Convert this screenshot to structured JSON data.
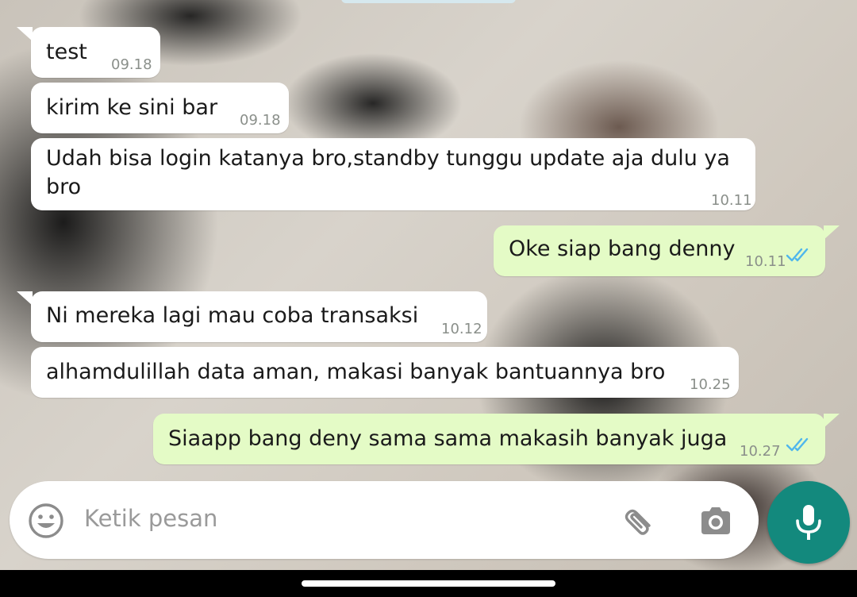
{
  "messages": [
    {
      "id": "m1",
      "direction": "in",
      "lines": [
        "test"
      ],
      "time": "09.18"
    },
    {
      "id": "m2",
      "direction": "in",
      "lines": [
        "kirim ke sini bar"
      ],
      "time": "09.18"
    },
    {
      "id": "m3",
      "direction": "in",
      "lines": [
        "Udah bisa login katanya bro,standby tunggu update aja dulu ya",
        "bro"
      ],
      "time": "10.11"
    },
    {
      "id": "m4",
      "direction": "out",
      "lines": [
        "Oke siap bang denny"
      ],
      "time": "10.11",
      "status": "read"
    },
    {
      "id": "m5",
      "direction": "in",
      "lines": [
        "Ni mereka lagi mau coba transaksi"
      ],
      "time": "10.12"
    },
    {
      "id": "m6",
      "direction": "in",
      "lines": [
        "alhamdulillah data aman, makasi banyak bantuannya bro"
      ],
      "time": "10.25"
    },
    {
      "id": "m7",
      "direction": "out",
      "lines": [
        "Siaapp bang deny sama sama makasih banyak juga"
      ],
      "time": "10.27",
      "status": "read"
    }
  ],
  "composer": {
    "placeholder": "Ketik pesan",
    "emoji_icon": "emoji-icon",
    "attach_icon": "paperclip-icon",
    "camera_icon": "camera-icon",
    "mic_icon": "microphone-icon"
  },
  "colors": {
    "incoming_bubble": "#ffffff",
    "outgoing_bubble": "#e4fbc6",
    "read_ticks": "#4fb6ec",
    "mic_button": "#13897d",
    "timestamp": "#8a8f8a"
  }
}
